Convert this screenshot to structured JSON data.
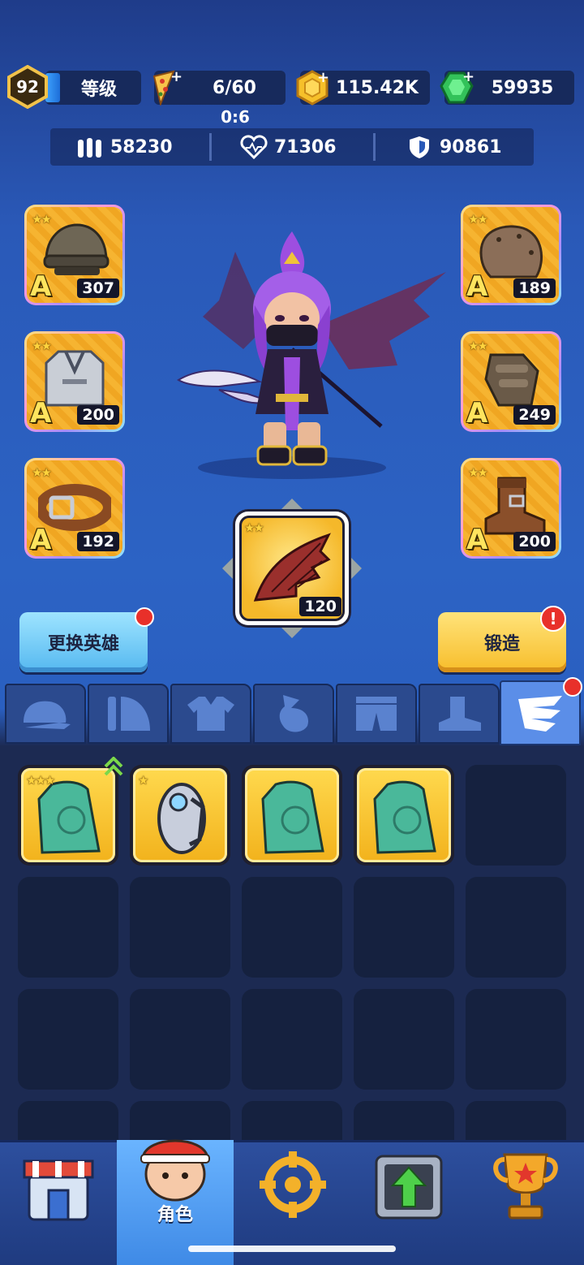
{
  "header": {
    "level": "92",
    "level_label": "等级",
    "energy": "6/60",
    "energy_timer": "0:6",
    "gold": "115.42K",
    "gems": "59935"
  },
  "stats": {
    "attack": "58230",
    "health": "71306",
    "defense": "90861"
  },
  "equipment": {
    "helmet": {
      "level": "307",
      "grade": "A",
      "stars": "★★"
    },
    "armor": {
      "level": "200",
      "grade": "A",
      "stars": "★★"
    },
    "belt": {
      "level": "192",
      "grade": "A",
      "stars": "★★"
    },
    "shoulder": {
      "level": "189",
      "grade": "A",
      "stars": "★★"
    },
    "gloves": {
      "level": "249",
      "grade": "A",
      "stars": "★★"
    },
    "boots": {
      "level": "200",
      "grade": "A",
      "stars": "★★"
    },
    "wings": {
      "level": "120",
      "stars": "★★"
    }
  },
  "buttons": {
    "change_hero": "更换英雄",
    "forge": "锻造",
    "forge_alert": "!"
  },
  "tabs": [
    "helmet-tab-icon",
    "shoulder-tab-icon",
    "armor-tab-icon",
    "gloves-tab-icon",
    "pants-tab-icon",
    "boots-tab-icon",
    "wings-tab-icon"
  ],
  "inventory": {
    "items": [
      {
        "stars": "★★★",
        "icon": "lion-cloak-icon"
      },
      {
        "stars": "★",
        "icon": "mech-wing-icon"
      },
      {
        "stars": "",
        "icon": "lion-cloak-icon"
      },
      {
        "stars": "",
        "icon": "lion-cloak-icon"
      }
    ]
  },
  "nav": {
    "active_label": "角色"
  },
  "colors": {
    "accent_gold": "#f5b82a",
    "alert_red": "#e8302a",
    "panel_dark": "#15213f"
  }
}
